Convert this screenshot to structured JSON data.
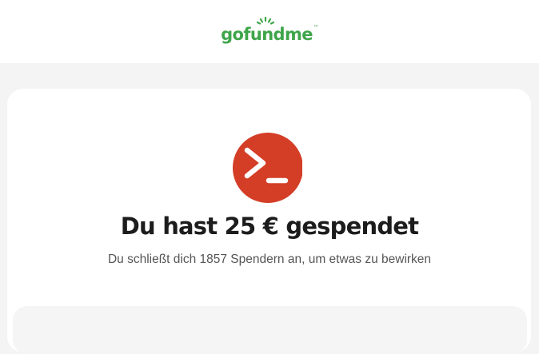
{
  "header": {
    "logo_text": "gofundme",
    "logo_tm": "™",
    "brand_color": "#3fa54a"
  },
  "donation": {
    "avatar_icon": "terminal-prompt-icon",
    "avatar_color": "#d43d26",
    "title": "Du hast 25 € gespendet",
    "subtitle": "Du schließt dich 1857 Spendern an, um etwas zu bewirken"
  }
}
